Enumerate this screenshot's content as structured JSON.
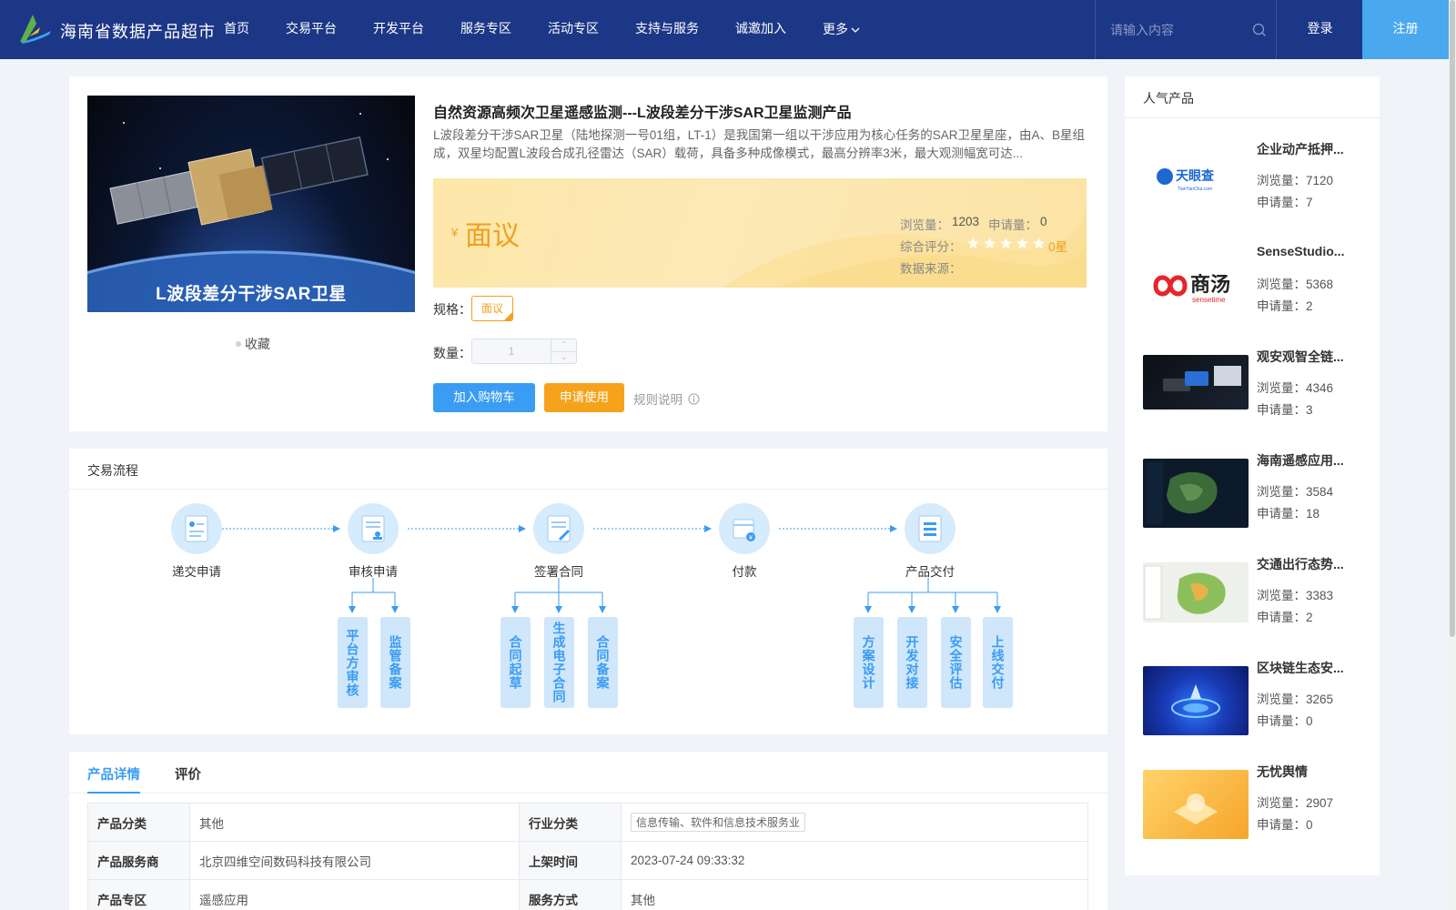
{
  "header": {
    "site_title": "海南省数据产品超市",
    "nav": [
      "首页",
      "交易平台",
      "开发平台",
      "服务专区",
      "活动专区",
      "支持与服务",
      "诚邀加入",
      "更多"
    ],
    "search_placeholder": "请输入内容",
    "login": "登录",
    "register": "注册",
    "colors": {
      "bar": "#1d3787",
      "register": "#4aa8ef"
    }
  },
  "product": {
    "image_caption": "L波段差分干涉SAR卫星",
    "favorite": "收藏",
    "title": "自然资源高频次卫星遥感监测---L波段差分干涉SAR卫星监测产品",
    "description": "L波段差分干涉SAR卫星（陆地探测一号01组，LT-1）是我国第一组以干涉应用为核心任务的SAR卫星星座，由A、B星组成，双星均配置L波段合成孔径雷达（SAR）载荷，具备多种成像模式，最高分辨率3米，最大观测幅宽可达...",
    "price_symbol": "¥",
    "price": "面议",
    "views_label": "浏览量：",
    "views": "1203",
    "applications_label": "申请量：",
    "applications": "0",
    "rating_label": "综合评分：",
    "rating_value": "0星",
    "rating_stars": 0,
    "source_label": "数据来源：",
    "spec_label": "规格：",
    "spec_option": "面议",
    "quantity_label": "数量：",
    "quantity": "1",
    "add_to_cart": "加入购物车",
    "apply": "申请使用",
    "rules": "规则说明",
    "accent": "#f0a020"
  },
  "process": {
    "title": "交易流程",
    "steps": [
      "递交申请",
      "审核申请",
      "签署合同",
      "付款",
      "产品交付"
    ],
    "sub_steps": {
      "review": [
        "平台方审核",
        "监管备案"
      ],
      "contract": [
        "合同起草",
        "生成电子合同",
        "合同备案"
      ],
      "delivery": [
        "方案设计",
        "开发对接",
        "安全评估",
        "上线交付"
      ]
    }
  },
  "details": {
    "tabs": [
      "产品详情",
      "评价"
    ],
    "rows": [
      {
        "k1": "产品分类",
        "v1": "其他",
        "k2": "行业分类",
        "v2": "信息传输、软件和信息技术服务业"
      },
      {
        "k1": "产品服务商",
        "v1": "北京四维空间数码科技有限公司",
        "k2": "上架时间",
        "v2": "2023-07-24 09:33:32"
      },
      {
        "k1": "产品专区",
        "v1": "遥感应用",
        "k2": "服务方式",
        "v2": "其他"
      }
    ]
  },
  "popular": {
    "title": "人气产品",
    "views_label": "浏览量：",
    "applications_label": "申请量：",
    "items": [
      {
        "name": "企业动产抵押...",
        "views": "7120",
        "applications": "7",
        "logo_text": "天眼查",
        "logo_sub": "TianYanCha.com"
      },
      {
        "name": "SenseStudio...",
        "views": "5368",
        "applications": "2",
        "logo_text": "商汤",
        "logo_sub": "sensetime"
      },
      {
        "name": "观安观智全链...",
        "views": "4346",
        "applications": "3"
      },
      {
        "name": "海南遥感应用...",
        "views": "3584",
        "applications": "18"
      },
      {
        "name": "交通出行态势...",
        "views": "3383",
        "applications": "2"
      },
      {
        "name": "区块链生态安...",
        "views": "3265",
        "applications": "0"
      },
      {
        "name": "无忧舆情",
        "views": "2907",
        "applications": "0"
      }
    ]
  }
}
